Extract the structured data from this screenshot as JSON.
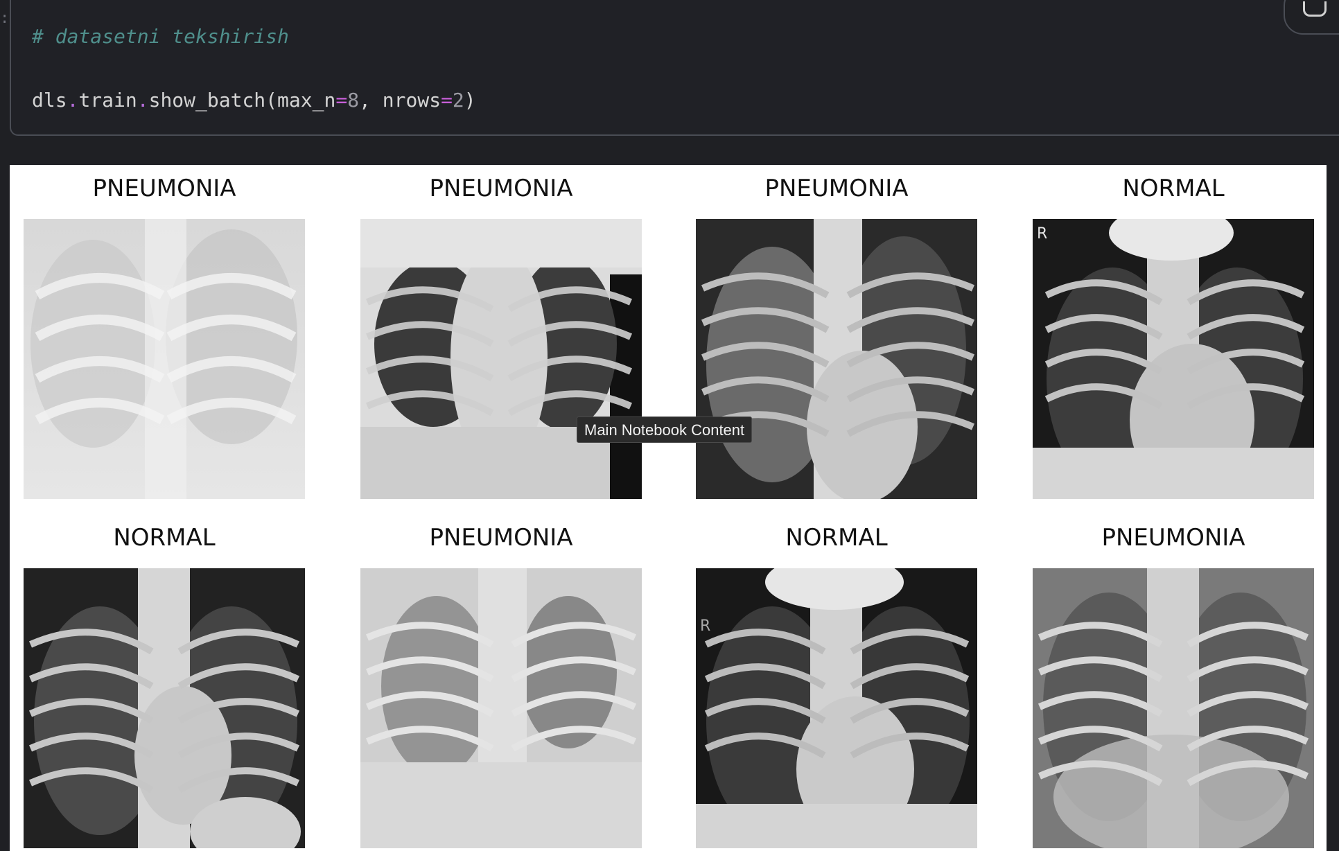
{
  "code_cell": {
    "gutter": ":",
    "comment": "# datasetni tekshirish",
    "call": {
      "obj": "dls",
      "attr": "train",
      "method": "show_batch(",
      "arg1_name": "max_n",
      "arg1_value": "8",
      "separator": ", ",
      "arg2_name": "nrows",
      "arg2_value": "2",
      "close": ")"
    }
  },
  "output": {
    "images": [
      {
        "label": "PNEUMONIA",
        "marker": ""
      },
      {
        "label": "PNEUMONIA",
        "marker": ""
      },
      {
        "label": "PNEUMONIA",
        "marker": ""
      },
      {
        "label": "NORMAL",
        "marker": "R"
      },
      {
        "label": "NORMAL",
        "marker": ""
      },
      {
        "label": "PNEUMONIA",
        "marker": ""
      },
      {
        "label": "NORMAL",
        "marker": "R"
      },
      {
        "label": "PNEUMONIA",
        "marker": ""
      }
    ]
  },
  "tooltip": {
    "text": "Main Notebook Content"
  },
  "icons": {
    "cell_action": "copy-icon"
  },
  "colors": {
    "background": "#1f2024",
    "comment": "#4f8f8c",
    "keyword_accent": "#c75fd8"
  }
}
